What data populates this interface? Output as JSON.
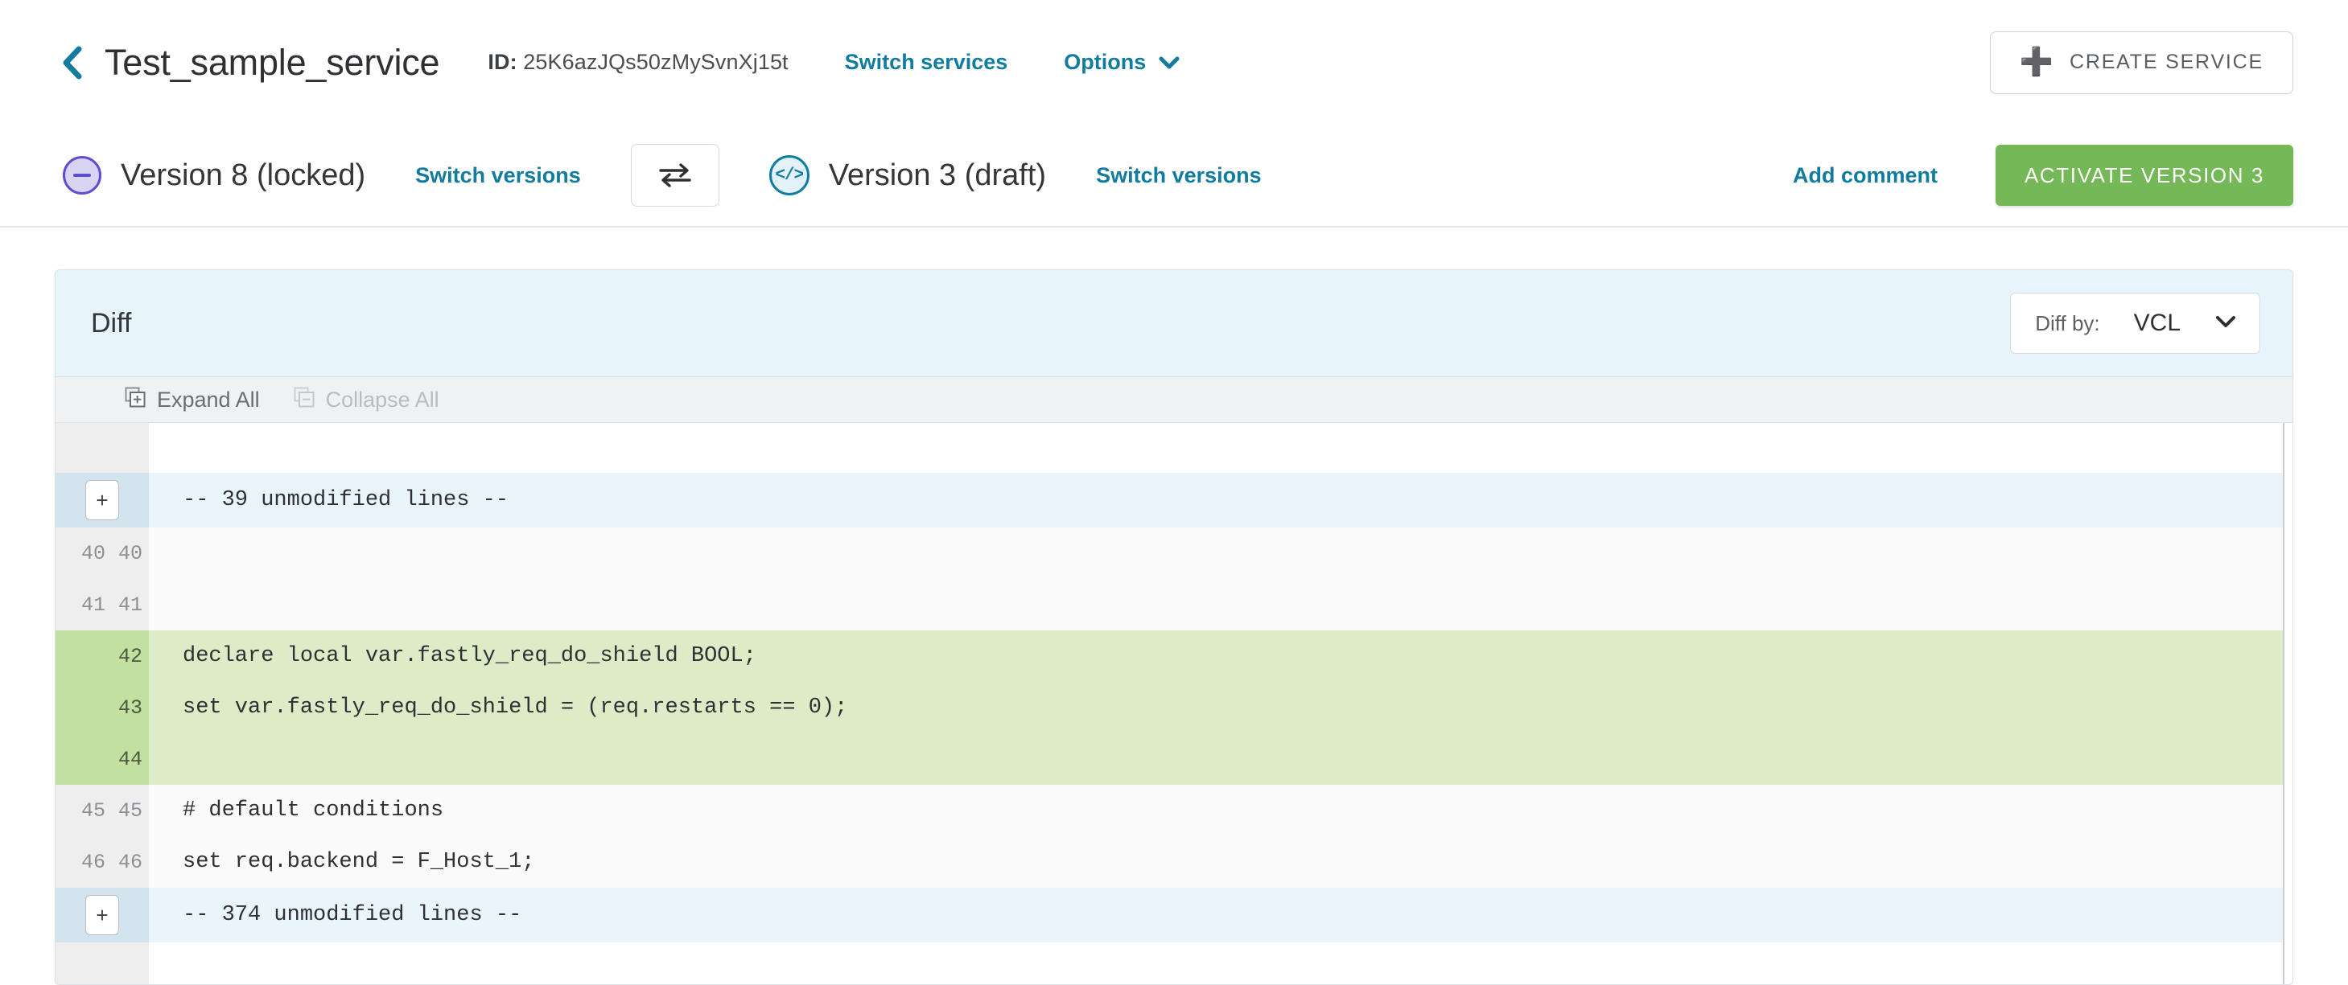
{
  "header": {
    "back_icon": "chevron-left-icon",
    "service_name": "Test_sample_service",
    "id_label": "ID:",
    "id_value": "25K6azJQs50zMySvnXj15t",
    "switch_services": "Switch services",
    "options": "Options",
    "options_caret_icon": "chevron-down-icon",
    "create_service": "CREATE SERVICE",
    "create_service_icon": "plus-icon"
  },
  "version_bar": {
    "left": {
      "status_icon": "locked-circle-minus-icon",
      "label": "Version 8 (locked)",
      "switch_versions": "Switch versions"
    },
    "swap_icon": "swap-arrows-icon",
    "right": {
      "status_icon": "code-draft-icon",
      "icon_glyph": "</>",
      "label": "Version 3 (draft)",
      "switch_versions": "Switch versions"
    },
    "add_comment": "Add comment",
    "activate": "ACTIVATE VERSION 3"
  },
  "diff": {
    "title": "Diff",
    "diff_by_label": "Diff by:",
    "diff_by_value": "VCL",
    "diff_by_caret_icon": "chevron-down-icon",
    "expand_all": "Expand All",
    "expand_all_icon": "stacked-squares-plus-icon",
    "collapse_all": "Collapse All",
    "collapse_all_icon": "stacked-squares-minus-icon",
    "expand_glyph": "+",
    "rows": [
      {
        "type": "blank",
        "old": "",
        "new": "",
        "text": ""
      },
      {
        "type": "collapsed",
        "old": "",
        "new": "",
        "text": "-- 39 unmodified lines --"
      },
      {
        "type": "context",
        "old": "40",
        "new": "40",
        "text": ""
      },
      {
        "type": "context",
        "old": "41",
        "new": "41",
        "text": ""
      },
      {
        "type": "added",
        "old": "",
        "new": "42",
        "text": "declare local var.fastly_req_do_shield BOOL;"
      },
      {
        "type": "added",
        "old": "",
        "new": "43",
        "text": "set var.fastly_req_do_shield = (req.restarts == 0);"
      },
      {
        "type": "added",
        "old": "",
        "new": "44",
        "text": ""
      },
      {
        "type": "context",
        "old": "45",
        "new": "45",
        "text": "# default conditions"
      },
      {
        "type": "context",
        "old": "46",
        "new": "46",
        "text": "set req.backend = F_Host_1;"
      },
      {
        "type": "collapsed",
        "old": "",
        "new": "",
        "text": "-- 374 unmodified lines --"
      },
      {
        "type": "tail",
        "old": "",
        "new": "",
        "text": ""
      }
    ]
  },
  "colors": {
    "link": "#127c9e",
    "activate_green": "#74b858",
    "added_bg": "#dcecc6",
    "added_gutter": "#c3e0a3",
    "collapsed_bg": "#eaf5fb",
    "collapsed_gutter": "#d3e4ef",
    "diff_header_bg": "#e8f4fb",
    "locked_purple": "#5b4fcf",
    "draft_blue": "#0d7ea2"
  }
}
